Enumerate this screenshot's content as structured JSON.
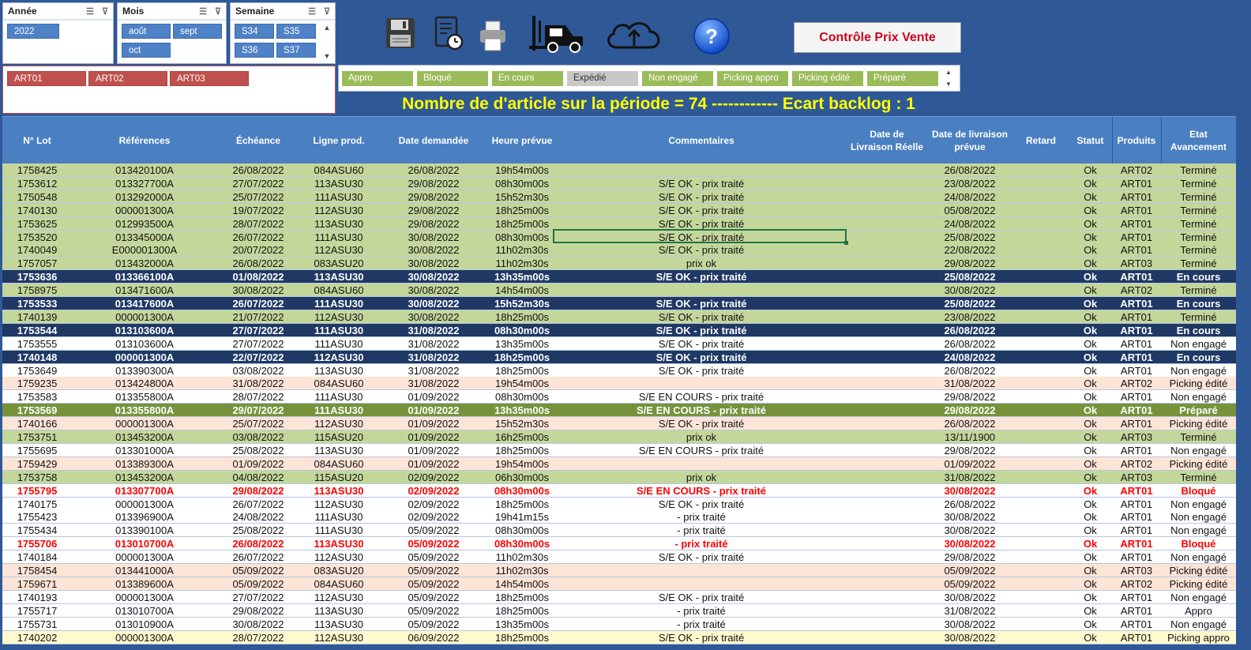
{
  "slicers": {
    "annee": {
      "title": "Année",
      "items": [
        "2022"
      ]
    },
    "mois": {
      "title": "Mois",
      "items": [
        "août",
        "sept",
        "oct"
      ]
    },
    "semaine": {
      "title": "Semaine",
      "items": [
        "S34",
        "S35",
        "S36",
        "S37"
      ]
    },
    "produits": {
      "items": [
        "ART01",
        "ART02",
        "ART03"
      ]
    }
  },
  "status_filter": {
    "items": [
      {
        "label": "Appro",
        "active": true
      },
      {
        "label": "Bloqué",
        "active": true
      },
      {
        "label": "En cours",
        "active": true
      },
      {
        "label": "Expédié",
        "active": false
      },
      {
        "label": "Non engagé",
        "active": true
      },
      {
        "label": "Picking appro",
        "active": true
      },
      {
        "label": "Picking édité",
        "active": true
      },
      {
        "label": "Préparé",
        "active": true
      }
    ]
  },
  "toolbar": {
    "icons": [
      "save-icon",
      "report-icon",
      "print-icon",
      "forklift-icon",
      "cloud-upload-icon",
      "help-icon"
    ],
    "help_label": "?",
    "control_button": "Contrôle Prix Vente"
  },
  "colors": {
    "background": "#2f5897",
    "header": "#4a7fc1",
    "banner": "#ffff00",
    "green_row": "#c4d79b",
    "navy_row": "#1f3864"
  },
  "banner": "Nombre de d'article sur la période = 74 ------------ Ecart backlog : 1",
  "table": {
    "headers": [
      "N° Lot",
      "Références",
      "Échéance",
      "Ligne prod.",
      "Date demandée",
      "Heure prévue",
      "Commentaires",
      "Date de Livraison Réelle",
      "Date de livraison prévue",
      "Retard",
      "Statut",
      "Produits",
      "Etat Avancement"
    ],
    "rows": [
      {
        "style": "green",
        "cells": [
          "1758425",
          "013420100A",
          "26/08/2022",
          "084ASU60",
          "26/08/2022",
          "19h54m00s",
          "",
          "",
          "26/08/2022",
          "",
          "Ok",
          "ART02",
          "Terminé"
        ]
      },
      {
        "style": "green",
        "cells": [
          "1753612",
          "013327700A",
          "27/07/2022",
          "113ASU30",
          "29/08/2022",
          "08h30m00s",
          "S/E OK - prix traité",
          "",
          "23/08/2022",
          "",
          "Ok",
          "ART01",
          "Terminé"
        ]
      },
      {
        "style": "green",
        "cells": [
          "1750548",
          "013292000A",
          "25/07/2022",
          "111ASU30",
          "29/08/2022",
          "15h52m30s",
          "S/E OK - prix traité",
          "",
          "24/08/2022",
          "",
          "Ok",
          "ART01",
          "Terminé"
        ]
      },
      {
        "style": "green",
        "cells": [
          "1740130",
          "000001300A",
          "19/07/2022",
          "112ASU30",
          "29/08/2022",
          "18h25m00s",
          "S/E OK - prix traité",
          "",
          "05/08/2022",
          "",
          "Ok",
          "ART01",
          "Terminé"
        ]
      },
      {
        "style": "green",
        "cells": [
          "1753625",
          "012993500A",
          "28/07/2022",
          "113ASU30",
          "29/08/2022",
          "18h25m00s",
          "S/E OK - prix traité",
          "",
          "24/08/2022",
          "",
          "Ok",
          "ART01",
          "Terminé"
        ]
      },
      {
        "style": "green",
        "cells": [
          "1753520",
          "013345000A",
          "26/07/2022",
          "111ASU30",
          "30/08/2022",
          "08h30m00s",
          "S/E OK - prix traité",
          "",
          "25/08/2022",
          "",
          "Ok",
          "ART01",
          "Terminé"
        ]
      },
      {
        "style": "green",
        "cells": [
          "1740049",
          "E000001300A",
          "20/07/2022",
          "112ASU30",
          "30/08/2022",
          "11h02m30s",
          "S/E OK - prix traité",
          "",
          "22/08/2022",
          "",
          "Ok",
          "ART01",
          "Terminé"
        ]
      },
      {
        "style": "green",
        "cells": [
          "1757057",
          "013432000A",
          "26/08/2022",
          "083ASU20",
          "30/08/2022",
          "11h02m30s",
          "prix ok",
          "",
          "29/08/2022",
          "",
          "Ok",
          "ART03",
          "Terminé"
        ]
      },
      {
        "style": "navy",
        "cells": [
          "1753636",
          "013366100A",
          "01/08/2022",
          "113ASU30",
          "30/08/2022",
          "13h35m00s",
          "S/E OK - prix traité",
          "",
          "25/08/2022",
          "",
          "Ok",
          "ART01",
          "En cours"
        ]
      },
      {
        "style": "green",
        "cells": [
          "1758975",
          "013471600A",
          "30/08/2022",
          "084ASU60",
          "30/08/2022",
          "14h54m00s",
          "",
          "",
          "30/08/2022",
          "",
          "Ok",
          "ART02",
          "Terminé"
        ]
      },
      {
        "style": "navy",
        "cells": [
          "1753533",
          "013417600A",
          "26/07/2022",
          "111ASU30",
          "30/08/2022",
          "15h52m30s",
          "S/E OK - prix traité",
          "",
          "25/08/2022",
          "",
          "Ok",
          "ART01",
          "En cours"
        ]
      },
      {
        "style": "green",
        "cells": [
          "1740139",
          "000001300A",
          "21/07/2022",
          "112ASU30",
          "30/08/2022",
          "18h25m00s",
          "S/E OK - prix traité",
          "",
          "23/08/2022",
          "",
          "Ok",
          "ART01",
          "Terminé"
        ]
      },
      {
        "style": "navy",
        "cells": [
          "1753544",
          "013103600A",
          "27/07/2022",
          "111ASU30",
          "31/08/2022",
          "08h30m00s",
          "S/E OK - prix traité",
          "",
          "26/08/2022",
          "",
          "Ok",
          "ART01",
          "En cours"
        ]
      },
      {
        "style": "white",
        "cells": [
          "1753555",
          "013103600A",
          "27/07/2022",
          "111ASU30",
          "31/08/2022",
          "13h35m00s",
          "S/E OK - prix traité",
          "",
          "26/08/2022",
          "",
          "Ok",
          "ART01",
          "Non engagé"
        ]
      },
      {
        "style": "navy",
        "cells": [
          "1740148",
          "000001300A",
          "22/07/2022",
          "112ASU30",
          "31/08/2022",
          "18h25m00s",
          "S/E OK - prix traité",
          "",
          "24/08/2022",
          "",
          "Ok",
          "ART01",
          "En cours"
        ]
      },
      {
        "style": "white",
        "cells": [
          "1753649",
          "013390300A",
          "03/08/2022",
          "113ASU30",
          "31/08/2022",
          "18h25m00s",
          "S/E OK - prix traité",
          "",
          "26/08/2022",
          "",
          "Ok",
          "ART01",
          "Non engagé"
        ]
      },
      {
        "style": "peach",
        "cells": [
          "1759235",
          "013424800A",
          "31/08/2022",
          "084ASU60",
          "31/08/2022",
          "19h54m00s",
          "",
          "",
          "31/08/2022",
          "",
          "Ok",
          "ART02",
          "Picking édité"
        ]
      },
      {
        "style": "white",
        "cells": [
          "1753583",
          "013355800A",
          "28/07/2022",
          "111ASU30",
          "01/09/2022",
          "08h30m00s",
          "S/E EN COURS - prix traité",
          "",
          "29/08/2022",
          "",
          "Ok",
          "ART01",
          "Non engagé"
        ]
      },
      {
        "style": "olive",
        "cells": [
          "1753569",
          "013355800A",
          "29/07/2022",
          "111ASU30",
          "01/09/2022",
          "13h35m00s",
          "S/E EN COURS - prix traité",
          "",
          "29/08/2022",
          "",
          "Ok",
          "ART01",
          "Préparé"
        ]
      },
      {
        "style": "peach",
        "cells": [
          "1740166",
          "000001300A",
          "25/07/2022",
          "112ASU30",
          "01/09/2022",
          "15h52m30s",
          "S/E OK - prix traité",
          "",
          "26/08/2022",
          "",
          "Ok",
          "ART01",
          "Picking édité"
        ]
      },
      {
        "style": "green",
        "cells": [
          "1753751",
          "013453200A",
          "03/08/2022",
          "115ASU20",
          "01/09/2022",
          "16h25m00s",
          "prix ok",
          "",
          "13/11/1900",
          "",
          "Ok",
          "ART03",
          "Terminé"
        ]
      },
      {
        "style": "white",
        "cells": [
          "1755695",
          "013301000A",
          "25/08/2022",
          "113ASU30",
          "01/09/2022",
          "18h25m00s",
          "S/E EN COURS - prix traité",
          "",
          "29/08/2022",
          "",
          "Ok",
          "ART01",
          "Non engagé"
        ]
      },
      {
        "style": "peach",
        "cells": [
          "1759429",
          "013389300A",
          "01/09/2022",
          "084ASU60",
          "01/09/2022",
          "19h54m00s",
          "",
          "",
          "01/09/2022",
          "",
          "Ok",
          "ART02",
          "Picking édité"
        ]
      },
      {
        "style": "green",
        "cells": [
          "1753758",
          "013453200A",
          "04/08/2022",
          "115ASU20",
          "02/09/2022",
          "06h30m00s",
          "prix ok",
          "",
          "31/08/2022",
          "",
          "Ok",
          "ART03",
          "Terminé"
        ]
      },
      {
        "style": "redtext",
        "cells": [
          "1755795",
          "013307700A",
          "29/08/2022",
          "113ASU30",
          "02/09/2022",
          "08h30m00s",
          "S/E EN COURS - prix traité",
          "",
          "30/08/2022",
          "",
          "Ok",
          "ART01",
          "Bloqué"
        ]
      },
      {
        "style": "white",
        "cells": [
          "1740175",
          "000001300A",
          "26/07/2022",
          "112ASU30",
          "02/09/2022",
          "18h25m00s",
          "S/E OK - prix traité",
          "",
          "26/08/2022",
          "",
          "Ok",
          "ART01",
          "Non engagé"
        ]
      },
      {
        "style": "white",
        "cells": [
          "1755423",
          "013396900A",
          "24/08/2022",
          "111ASU30",
          "02/09/2022",
          "19h41m15s",
          "- prix traité",
          "",
          "30/08/2022",
          "",
          "Ok",
          "ART01",
          "Non engagé"
        ]
      },
      {
        "style": "white",
        "cells": [
          "1755434",
          "013390100A",
          "25/08/2022",
          "111ASU30",
          "05/09/2022",
          "08h30m00s",
          "- prix traité",
          "",
          "30/08/2022",
          "",
          "Ok",
          "ART01",
          "Non engagé"
        ]
      },
      {
        "style": "redtext",
        "cells": [
          "1755706",
          "013010700A",
          "26/08/2022",
          "113ASU30",
          "05/09/2022",
          "08h30m00s",
          "- prix traité",
          "",
          "30/08/2022",
          "",
          "Ok",
          "ART01",
          "Bloqué"
        ]
      },
      {
        "style": "white",
        "cells": [
          "1740184",
          "000001300A",
          "26/07/2022",
          "112ASU30",
          "05/09/2022",
          "11h02m30s",
          "S/E OK - prix traité",
          "",
          "29/08/2022",
          "",
          "Ok",
          "ART01",
          "Non engagé"
        ]
      },
      {
        "style": "peach",
        "cells": [
          "1758454",
          "013441000A",
          "05/09/2022",
          "083ASU20",
          "05/09/2022",
          "11h02m30s",
          "",
          "",
          "05/09/2022",
          "",
          "Ok",
          "ART03",
          "Picking édité"
        ]
      },
      {
        "style": "peach",
        "cells": [
          "1759671",
          "013389600A",
          "05/09/2022",
          "084ASU60",
          "05/09/2022",
          "14h54m00s",
          "",
          "",
          "05/09/2022",
          "",
          "Ok",
          "ART02",
          "Picking édité"
        ]
      },
      {
        "style": "white",
        "cells": [
          "1740193",
          "000001300A",
          "27/07/2022",
          "112ASU30",
          "05/09/2022",
          "18h25m00s",
          "S/E OK - prix traité",
          "",
          "30/08/2022",
          "",
          "Ok",
          "ART01",
          "Non engagé"
        ]
      },
      {
        "style": "white",
        "cells": [
          "1755717",
          "013010700A",
          "29/08/2022",
          "113ASU30",
          "05/09/2022",
          "18h25m00s",
          "- prix traité",
          "",
          "31/08/2022",
          "",
          "Ok",
          "ART01",
          "Appro"
        ]
      },
      {
        "style": "white",
        "cells": [
          "1755731",
          "013010900A",
          "30/08/2022",
          "113ASU30",
          "05/09/2022",
          "13h35m00s",
          "- prix traité",
          "",
          "30/08/2022",
          "",
          "Ok",
          "ART01",
          "Non engagé"
        ]
      },
      {
        "style": "yellow",
        "cells": [
          "1740202",
          "000001300A",
          "28/07/2022",
          "112ASU30",
          "06/09/2022",
          "18h25m00s",
          "S/E OK - prix traité",
          "",
          "30/08/2022",
          "",
          "Ok",
          "ART01",
          "Picking appro"
        ]
      }
    ]
  }
}
